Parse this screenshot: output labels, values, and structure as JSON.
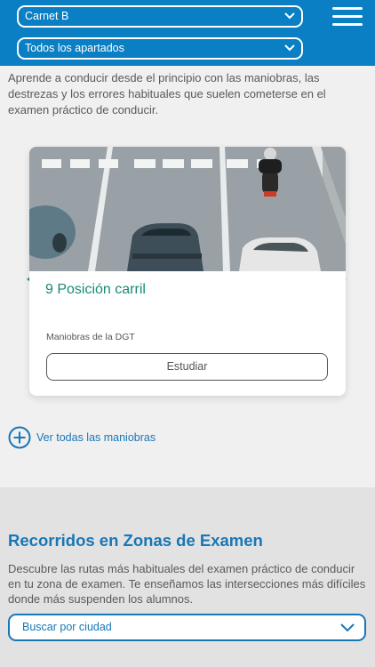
{
  "header": {
    "license_select": "Carnet B",
    "section_select": "Todos los apartados"
  },
  "intro_text": "Aprende a conducir desde el principio con las maniobras, las destrezas y los errores habituales que suelen cometerse en el examen práctico de conducir.",
  "card": {
    "title": "9 Posición carril",
    "subtitle": "Maniobras de la DGT",
    "button": "Estudiar"
  },
  "see_all": "Ver todas las maniobras",
  "routes": {
    "title": "Recorridos en Zonas de Examen",
    "description": "Descubre las rutas más habituales del examen práctico de conducir en tu zona de examen. Te enseñamos las intersecciones más difíciles donde más suspenden los alumnos.",
    "city_select": "Buscar por ciudad"
  },
  "colors": {
    "header": "#0a7fc4",
    "accent_green": "#168b73",
    "link_blue": "#1877b6"
  }
}
